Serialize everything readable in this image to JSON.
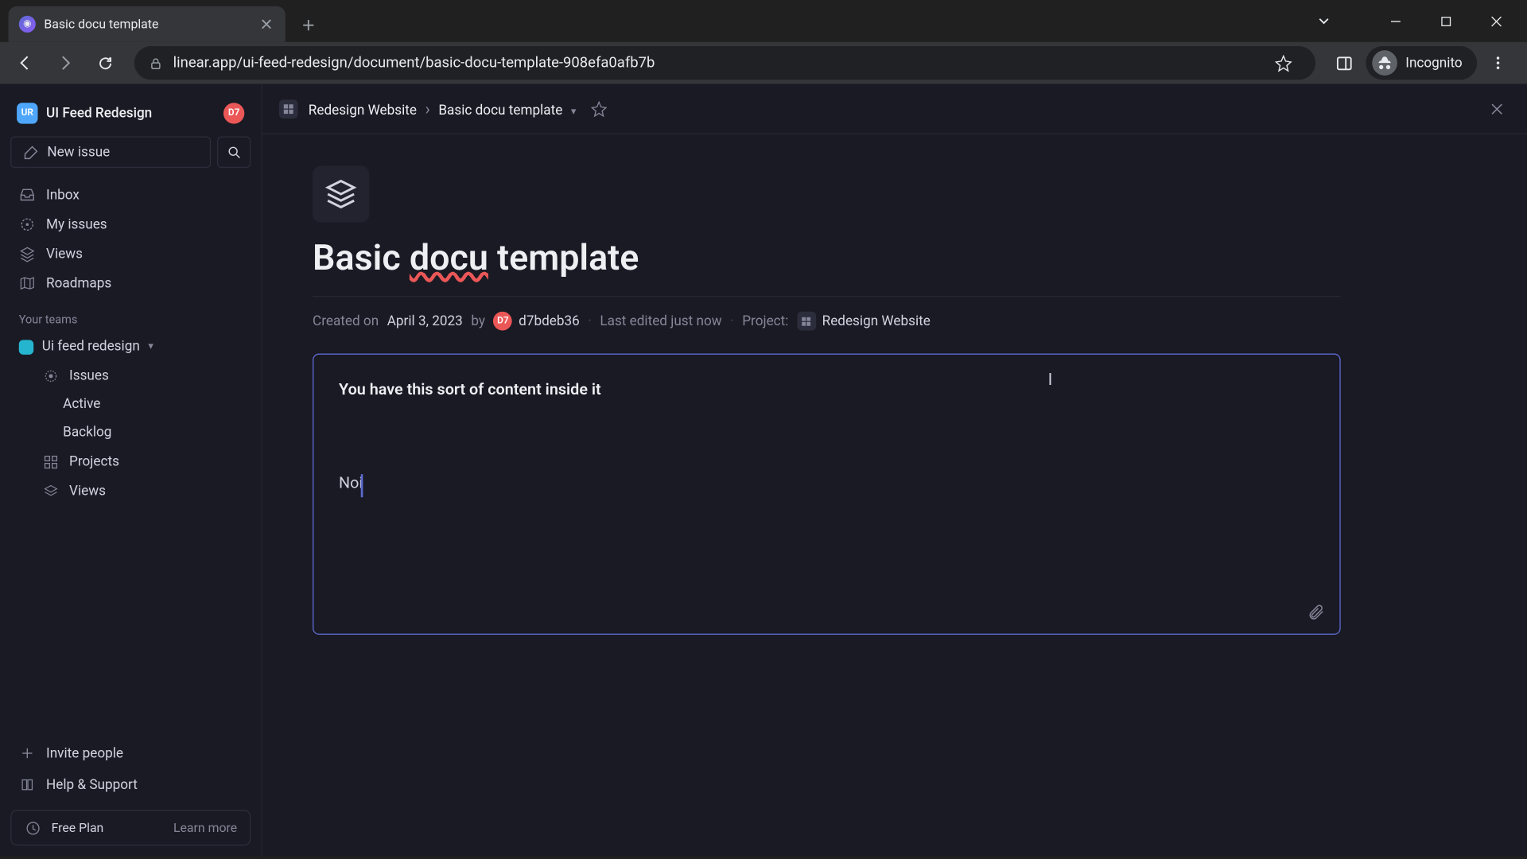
{
  "browser": {
    "tab_title": "Basic docu template",
    "url": "linear.app/ui-feed-redesign/document/basic-docu-template-908efa0afb7b",
    "incognito_label": "Incognito"
  },
  "workspace": {
    "badge": "UR",
    "name": "UI Feed Redesign",
    "user_badge": "D7"
  },
  "sidebar": {
    "new_issue": "New issue",
    "nav": {
      "inbox": "Inbox",
      "my_issues": "My issues",
      "views": "Views",
      "roadmaps": "Roadmaps"
    },
    "teams_label": "Your teams",
    "team_name": "Ui feed redesign",
    "team_items": {
      "issues": "Issues",
      "active": "Active",
      "backlog": "Backlog",
      "projects": "Projects",
      "views": "Views"
    },
    "footer": {
      "invite": "Invite people",
      "help": "Help & Support",
      "plan": "Free Plan",
      "learn_more": "Learn more"
    }
  },
  "breadcrumb": {
    "project": "Redesign Website",
    "doc": "Basic docu template"
  },
  "document": {
    "title_pre": "Basic ",
    "title_spell": "docu",
    "title_post": " template",
    "created_prefix": "Created on ",
    "created_date": "April 3, 2023",
    "by": " by ",
    "author_badge": "D7",
    "author": "d7bdeb36",
    "last_edited": "Last edited just now",
    "project_label": "Project:",
    "project_name": "Redesign Website",
    "content_bold": "You have this sort of content inside it",
    "content_line": "Noi"
  }
}
